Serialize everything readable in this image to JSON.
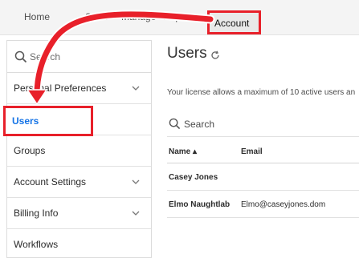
{
  "topnav": {
    "items": [
      "Home",
      "Send",
      "Manage",
      "Reports"
    ],
    "active": "Account"
  },
  "sidebar": {
    "search_label": "Search",
    "items": [
      "Personal Preferences",
      "Users",
      "Groups",
      "Account Settings",
      "Billing Info",
      "Workflows"
    ]
  },
  "main": {
    "title": "Users",
    "license_text": "Your license allows a maximum of 10 active users an",
    "search_label": "Search",
    "columns": [
      "Name ▴",
      "Email"
    ],
    "rows": [
      {
        "name": "Casey Jones",
        "email": ""
      },
      {
        "name": "Elmo Naughtlab",
        "email": "Elmo@caseyjones.dom"
      }
    ]
  },
  "colors": {
    "highlight": "#e8202a",
    "link": "#1473e6"
  }
}
